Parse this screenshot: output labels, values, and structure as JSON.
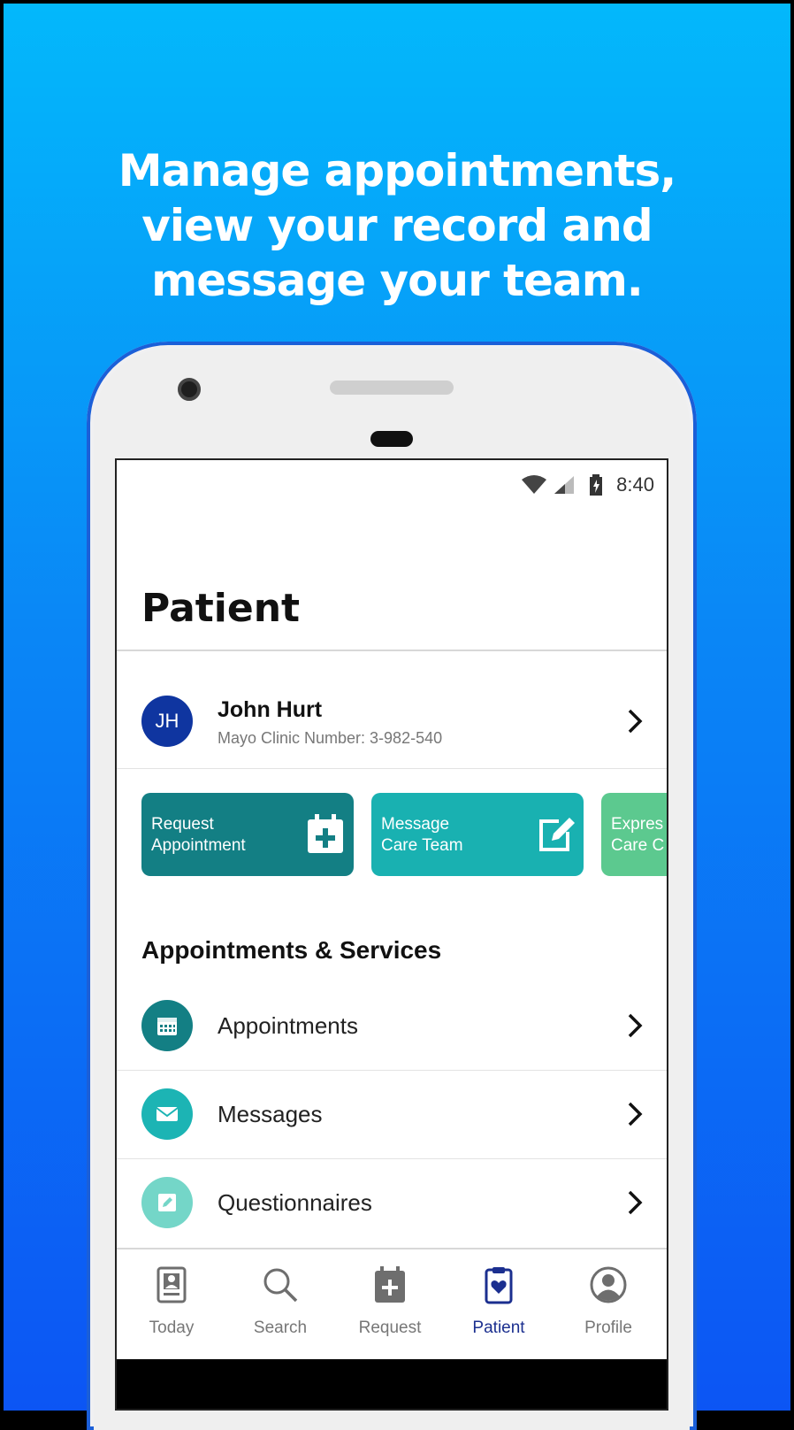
{
  "headline": [
    "Manage appointments,",
    "view your record and",
    "message your team."
  ],
  "status_bar": {
    "time": "8:40",
    "icons": [
      "wifi-icon",
      "cell-signal-icon",
      "battery-charging-icon"
    ]
  },
  "page": {
    "title": "Patient"
  },
  "patient": {
    "initials": "JH",
    "name": "John Hurt",
    "clinic_number": "Mayo Clinic Number: 3-982-540"
  },
  "quick_actions": [
    {
      "line1": "Request",
      "line2": "Appointment",
      "icon": "calendar-plus-icon",
      "color": "#137f84"
    },
    {
      "line1": "Message",
      "line2": "Care Team",
      "icon": "compose-icon",
      "color": "#19b1b1"
    },
    {
      "line1": "Expres",
      "line2": "Care C",
      "icon": "",
      "color": "#5cc98f"
    }
  ],
  "section": {
    "title": "Appointments & Services"
  },
  "services": [
    {
      "label": "Appointments",
      "icon": "calendar-icon",
      "color": "#137f84"
    },
    {
      "label": "Messages",
      "icon": "envelope-icon",
      "color": "#1cb4b4"
    },
    {
      "label": "Questionnaires",
      "icon": "pencil-icon",
      "color": "#74d6c8"
    }
  ],
  "tabs": [
    {
      "label": "Today",
      "icon": "today-card-icon",
      "active": false
    },
    {
      "label": "Search",
      "icon": "search-icon",
      "active": false
    },
    {
      "label": "Request",
      "icon": "request-calendar-icon",
      "active": false
    },
    {
      "label": "Patient",
      "icon": "clipboard-heart-icon",
      "active": true
    },
    {
      "label": "Profile",
      "icon": "profile-icon",
      "active": false
    }
  ]
}
